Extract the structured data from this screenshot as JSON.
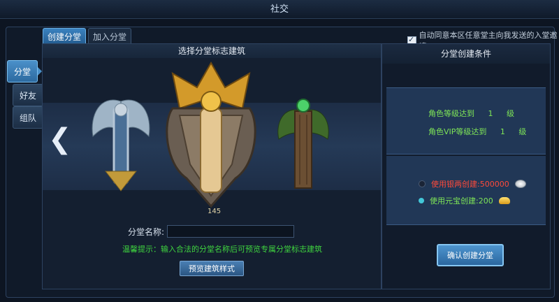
{
  "window": {
    "title": "社交"
  },
  "side_tabs": [
    {
      "label": "分堂",
      "active": true
    },
    {
      "label": "好友",
      "active": false
    },
    {
      "label": "组队",
      "active": false
    }
  ],
  "top_tabs": [
    {
      "label": "创建分堂",
      "active": true
    },
    {
      "label": "加入分堂",
      "active": false
    }
  ],
  "auto_accept": {
    "label": "自动同意本区任意堂主向我发送的入堂邀请",
    "checked": true
  },
  "left_panel": {
    "title": "选择分堂标志建筑",
    "carousel_count": "145",
    "name_label": "分堂名称:",
    "name_value": "",
    "tip": "温馨提示：输入合法的分堂名称后可预览专属分堂标志建筑",
    "preview_button": "预览建筑样式"
  },
  "right_panel": {
    "title": "分堂创建条件",
    "conditions": [
      {
        "label": "角色等级达到",
        "value": "1",
        "unit": "级"
      },
      {
        "label": "角色VIP等级达到",
        "value": "1",
        "unit": "级"
      }
    ],
    "costs": [
      {
        "label": "使用银两创建:",
        "value": "500000",
        "color": "#ff4a3a",
        "icon": "silver-coin-icon"
      },
      {
        "label": "使用元宝创建:",
        "value": "200",
        "color": "#7fe657",
        "icon": "gold-ingot-icon"
      }
    ],
    "confirm_button": "确认创建分堂"
  },
  "colors": {
    "accent": "#3b82c0",
    "green_text": "#7fe657",
    "red_text": "#ff4a3a"
  }
}
